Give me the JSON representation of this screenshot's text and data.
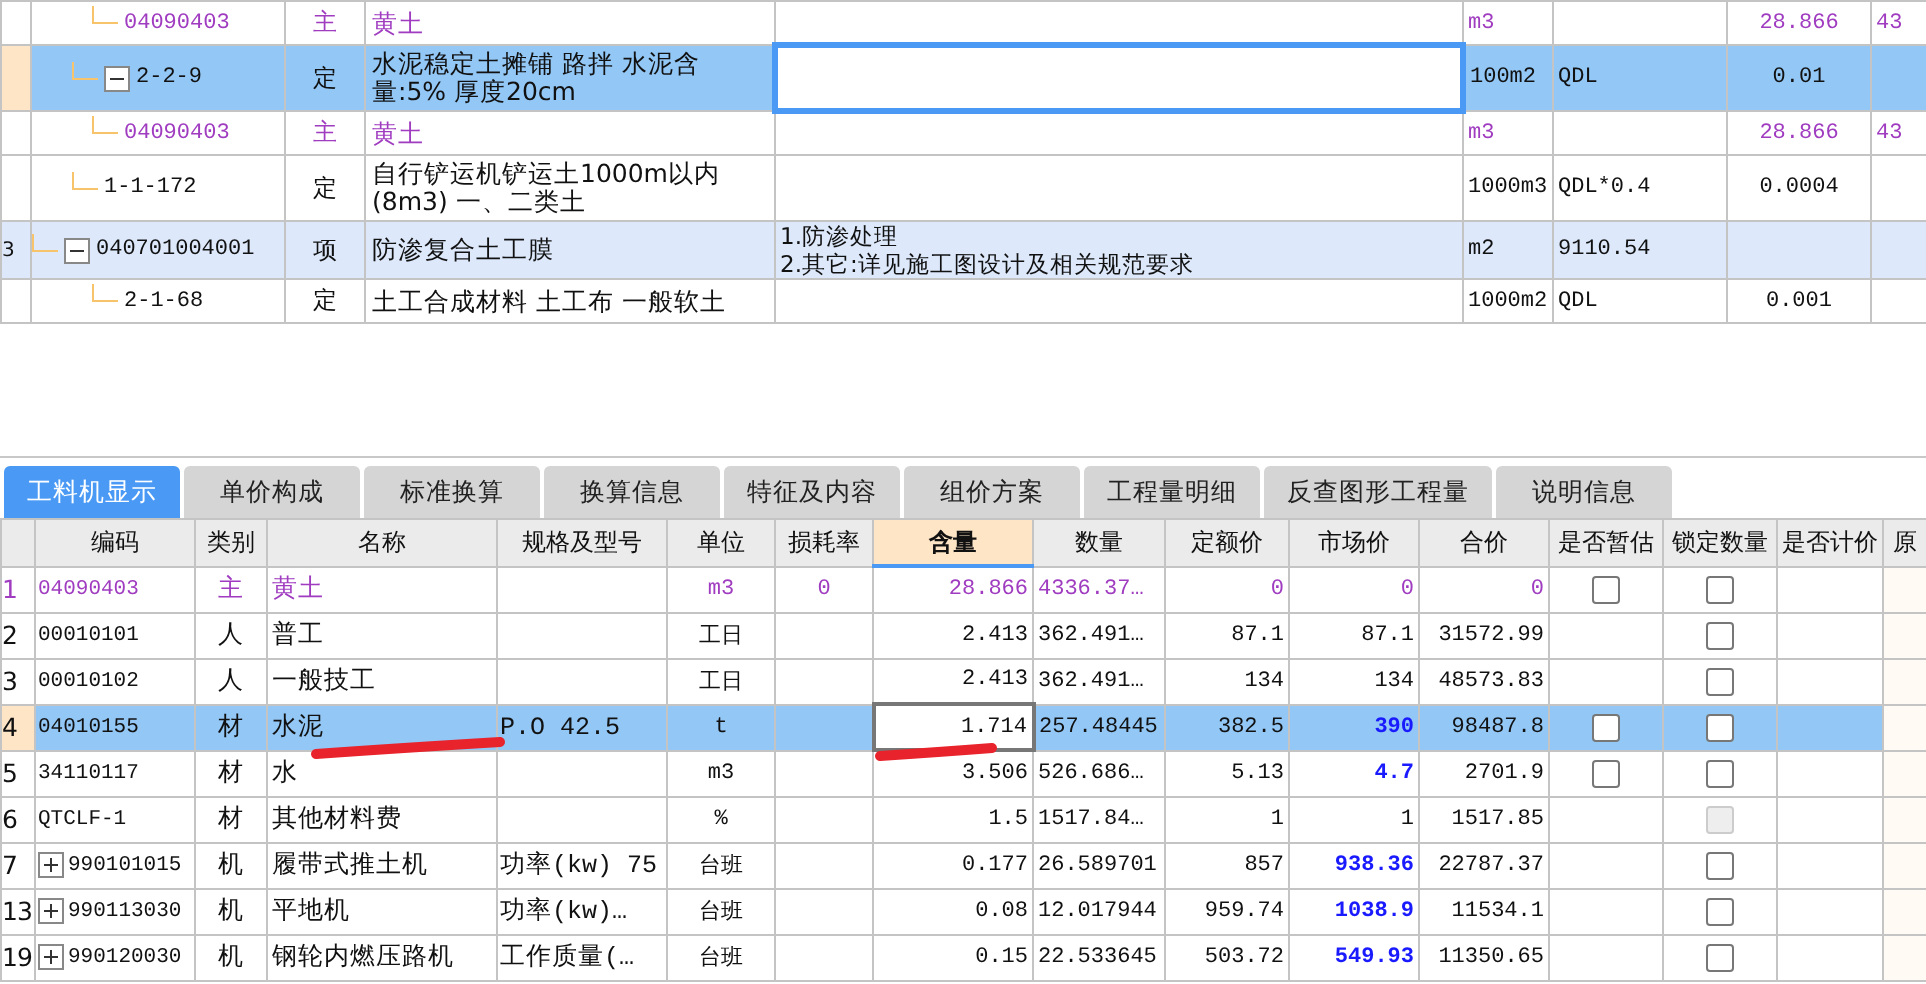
{
  "top_table": {
    "rows": [
      {
        "kind": "main",
        "code": "04090403",
        "type": "主",
        "name": "黄土",
        "unit": "m3",
        "quantity": "28.866",
        "column_9": "43",
        "selected": false
      },
      {
        "kind": "quota",
        "code": "2-2-9",
        "type": "定",
        "name": "水泥稳定土摊铺 路拌 水泥含量:5% 厚度20cm",
        "unit": "100m2",
        "expression": "QDL",
        "quantity": "0.01",
        "selected": true,
        "expanded": true,
        "children": [
          {
            "kind": "main",
            "code": "04090403",
            "type": "主",
            "name": "黄土",
            "unit": "m3",
            "quantity": "28.866",
            "column_9": "43",
            "selected": false
          }
        ]
      },
      {
        "kind": "quota",
        "code": "1-1-172",
        "type": "定",
        "name": "自行铲运机铲运土1000m以内(8m3) 一、二类土",
        "unit": "1000m3",
        "expression": "QDL*0.4",
        "quantity": "0.0004",
        "selected": false
      },
      {
        "kind": "item",
        "row_number": "3",
        "code": "040701004001",
        "type": "项",
        "name": "防渗复合土工膜",
        "feature": "1.防渗处理\n2.其它:详见施工图设计及相关规范要求",
        "unit": "m2",
        "expression": "9110.54",
        "selected": false,
        "expanded": true,
        "children": [
          {
            "kind": "quota",
            "code": "2-1-68",
            "type": "定",
            "name": "土工合成材料 土工布 一般软土",
            "unit": "1000m2",
            "expression": "QDL",
            "quantity": "0.001",
            "selected": false
          }
        ]
      }
    ]
  },
  "tabs": [
    {
      "label": "工料机显示",
      "selected": true
    },
    {
      "label": "单价构成",
      "selected": false
    },
    {
      "label": "标准换算",
      "selected": false
    },
    {
      "label": "换算信息",
      "selected": false
    },
    {
      "label": "特征及内容",
      "selected": false
    },
    {
      "label": "组价方案",
      "selected": false
    },
    {
      "label": "工程量明细",
      "selected": false
    },
    {
      "label": "反查图形工程量",
      "selected": false
    },
    {
      "label": "说明信息",
      "selected": false
    }
  ],
  "resource_table": {
    "columns": [
      {
        "selected": false
      },
      {
        "label": "编码",
        "selected": false
      },
      {
        "label": "类别",
        "selected": false
      },
      {
        "label": "名称",
        "selected": false
      },
      {
        "label": "规格及型号",
        "selected": false
      },
      {
        "label": "单位",
        "selected": false
      },
      {
        "label": "损耗率",
        "selected": false
      },
      {
        "label": "含量",
        "selected": true
      },
      {
        "label": "数量",
        "selected": false
      },
      {
        "label": "定额价",
        "selected": false
      },
      {
        "label": "市场价",
        "selected": false
      },
      {
        "label": "合价",
        "selected": false
      },
      {
        "label": "是否暂估",
        "selected": false
      },
      {
        "label": "锁定数量",
        "selected": false
      },
      {
        "label": "是否计价",
        "selected": false
      },
      {
        "label": "原",
        "selected": false
      }
    ],
    "rows": [
      {
        "kind": "main",
        "row_number": "1",
        "expandable": false,
        "code": "04090403",
        "type": "主",
        "name": "黄土",
        "unit": "m3",
        "loss_rate": "0",
        "content": "28.866",
        "quantity": "4336.37…",
        "quota_price": "0",
        "market_price": "0",
        "market_adjusted": false,
        "total": "0",
        "estimate": {
          "checked": false
        },
        "lock": {
          "checked": false,
          "disabled": false
        },
        "selected": false
      },
      {
        "kind": "labor",
        "row_number": "2",
        "expandable": false,
        "code": "00010101",
        "type": "人",
        "name": "普工",
        "unit": "工日",
        "content": "2.413",
        "quantity": "362.491…",
        "quota_price": "87.1",
        "market_price": "87.1",
        "market_adjusted": false,
        "total": "31572.99",
        "lock": {
          "checked": false,
          "disabled": false
        },
        "selected": false
      },
      {
        "kind": "labor",
        "row_number": "3",
        "expandable": false,
        "code": "00010102",
        "type": "人",
        "name": "一般技工",
        "unit": "工日",
        "content": "2.413",
        "quantity": "362.491…",
        "quota_price": "134",
        "market_price": "134",
        "market_adjusted": false,
        "total": "48573.83",
        "lock": {
          "checked": false,
          "disabled": false
        },
        "selected": false
      },
      {
        "kind": "material",
        "row_number": "4",
        "expandable": false,
        "code": "04010155",
        "type": "材",
        "name": "水泥",
        "spec": "P.O 42.5",
        "unit": "t",
        "content": "1.714",
        "quantity": "257.48445",
        "quota_price": "382.5",
        "market_price": "390",
        "market_adjusted": true,
        "total": "98487.8",
        "estimate": {
          "checked": false
        },
        "lock": {
          "checked": false,
          "disabled": false
        },
        "selected": true
      },
      {
        "kind": "material",
        "row_number": "5",
        "expandable": false,
        "code": "34110117",
        "type": "材",
        "name": "水",
        "unit": "m3",
        "content": "3.506",
        "quantity": "526.686…",
        "quota_price": "5.13",
        "market_price": "4.7",
        "market_adjusted": true,
        "total": "2701.9",
        "estimate": {
          "checked": false
        },
        "lock": {
          "checked": false,
          "disabled": false
        },
        "selected": false
      },
      {
        "kind": "material",
        "row_number": "6",
        "expandable": false,
        "code": "QTCLF-1",
        "type": "材",
        "name": "其他材料费",
        "unit": "%",
        "content": "1.5",
        "quantity": "1517.84…",
        "quota_price": "1",
        "market_price": "1",
        "market_adjusted": false,
        "total": "1517.85",
        "lock": {
          "checked": false,
          "disabled": true
        },
        "selected": false
      },
      {
        "kind": "machine",
        "row_number": "7",
        "expandable": true,
        "code": "990101015",
        "type": "机",
        "name": "履带式推土机",
        "spec": "功率(kw) 75",
        "unit": "台班",
        "content": "0.177",
        "quantity": "26.589701",
        "quota_price": "857",
        "market_price": "938.36",
        "market_adjusted": true,
        "total": "22787.37",
        "lock": {
          "checked": false,
          "disabled": false
        },
        "selected": false
      },
      {
        "kind": "machine",
        "row_number": "13",
        "expandable": true,
        "code": "990113030",
        "type": "机",
        "name": "平地机",
        "spec": "功率(kw)…",
        "unit": "台班",
        "content": "0.08",
        "quantity": "12.017944",
        "quota_price": "959.74",
        "market_price": "1038.9",
        "market_adjusted": true,
        "total": "11534.1",
        "lock": {
          "checked": false,
          "disabled": false
        },
        "selected": false
      },
      {
        "kind": "machine",
        "row_number": "19",
        "expandable": true,
        "code": "990120030",
        "type": "机",
        "name": "钢轮内燃压路机",
        "spec": "工作质量(…",
        "unit": "台班",
        "content": "0.15",
        "quantity": "22.533645",
        "quota_price": "503.72",
        "market_price": "549.93",
        "market_adjusted": true,
        "total": "11350.65",
        "lock": {
          "checked": false,
          "disabled": false
        },
        "selected": false
      }
    ]
  }
}
